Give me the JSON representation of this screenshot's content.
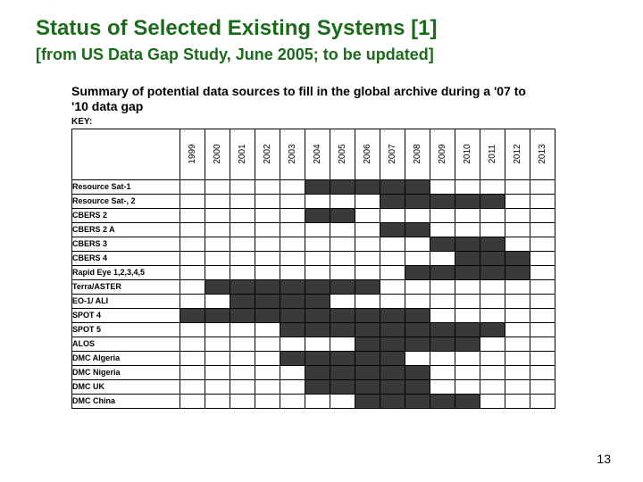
{
  "title": "Status of Selected Existing Systems [1]",
  "subtitle": "[from US Data Gap Study, June 2005; to be updated]",
  "page_number": "13",
  "chart_data": {
    "type": "heatmap",
    "title": "Summary of potential data sources to fill in the global archive during a '07 to '10 data gap",
    "key_label": "KEY:",
    "xlabel": "",
    "ylabel": "",
    "categories": [
      "1999",
      "2000",
      "2001",
      "2002",
      "2003",
      "2004",
      "2005",
      "2006",
      "2007",
      "2008",
      "2009",
      "2010",
      "2011",
      "2012",
      "2013"
    ],
    "series": [
      {
        "name": "Resource Sat-1",
        "values": [
          0,
          0,
          0,
          0,
          0,
          1,
          1,
          1,
          1,
          1,
          0,
          0,
          0,
          0,
          0
        ]
      },
      {
        "name": "Resource Sat-, 2",
        "values": [
          0,
          0,
          0,
          0,
          0,
          0,
          0,
          0,
          1,
          1,
          1,
          1,
          1,
          0,
          0
        ]
      },
      {
        "name": "CBERS 2",
        "values": [
          0,
          0,
          0,
          0,
          0,
          1,
          1,
          0,
          0,
          0,
          0,
          0,
          0,
          0,
          0
        ]
      },
      {
        "name": "CBERS 2 A",
        "values": [
          0,
          0,
          0,
          0,
          0,
          0,
          0,
          0,
          1,
          1,
          0,
          0,
          0,
          0,
          0
        ]
      },
      {
        "name": "CBERS 3",
        "values": [
          0,
          0,
          0,
          0,
          0,
          0,
          0,
          0,
          0,
          0,
          1,
          1,
          1,
          0,
          0
        ]
      },
      {
        "name": "CBERS 4",
        "values": [
          0,
          0,
          0,
          0,
          0,
          0,
          0,
          0,
          0,
          0,
          0,
          1,
          1,
          1,
          0
        ]
      },
      {
        "name": "Rapid Eye 1,2,3,4,5",
        "values": [
          0,
          0,
          0,
          0,
          0,
          0,
          0,
          0,
          0,
          1,
          1,
          1,
          1,
          1,
          0
        ]
      },
      {
        "name": "Terra/ASTER",
        "values": [
          0,
          1,
          1,
          1,
          1,
          1,
          1,
          1,
          0,
          0,
          0,
          0,
          0,
          0,
          0
        ]
      },
      {
        "name": "EO-1/ ALI",
        "values": [
          0,
          0,
          1,
          1,
          1,
          1,
          0,
          0,
          0,
          0,
          0,
          0,
          0,
          0,
          0
        ]
      },
      {
        "name": "SPOT 4",
        "values": [
          1,
          1,
          1,
          1,
          1,
          1,
          1,
          1,
          1,
          1,
          0,
          0,
          0,
          0,
          0
        ]
      },
      {
        "name": "SPOT 5",
        "values": [
          0,
          0,
          0,
          0,
          1,
          1,
          1,
          1,
          1,
          1,
          1,
          1,
          1,
          0,
          0
        ]
      },
      {
        "name": "ALOS",
        "values": [
          0,
          0,
          0,
          0,
          0,
          0,
          0,
          1,
          1,
          1,
          1,
          1,
          0,
          0,
          0
        ]
      },
      {
        "name": "DMC Algeria",
        "values": [
          0,
          0,
          0,
          0,
          1,
          1,
          1,
          1,
          1,
          0,
          0,
          0,
          0,
          0,
          0
        ]
      },
      {
        "name": "DMC Nigeria",
        "values": [
          0,
          0,
          0,
          0,
          0,
          1,
          1,
          1,
          1,
          1,
          0,
          0,
          0,
          0,
          0
        ]
      },
      {
        "name": "DMC UK",
        "values": [
          0,
          0,
          0,
          0,
          0,
          1,
          1,
          1,
          1,
          1,
          0,
          0,
          0,
          0,
          0
        ]
      },
      {
        "name": "DMC China",
        "values": [
          0,
          0,
          0,
          0,
          0,
          0,
          0,
          1,
          1,
          1,
          1,
          1,
          0,
          0,
          0
        ]
      }
    ]
  }
}
